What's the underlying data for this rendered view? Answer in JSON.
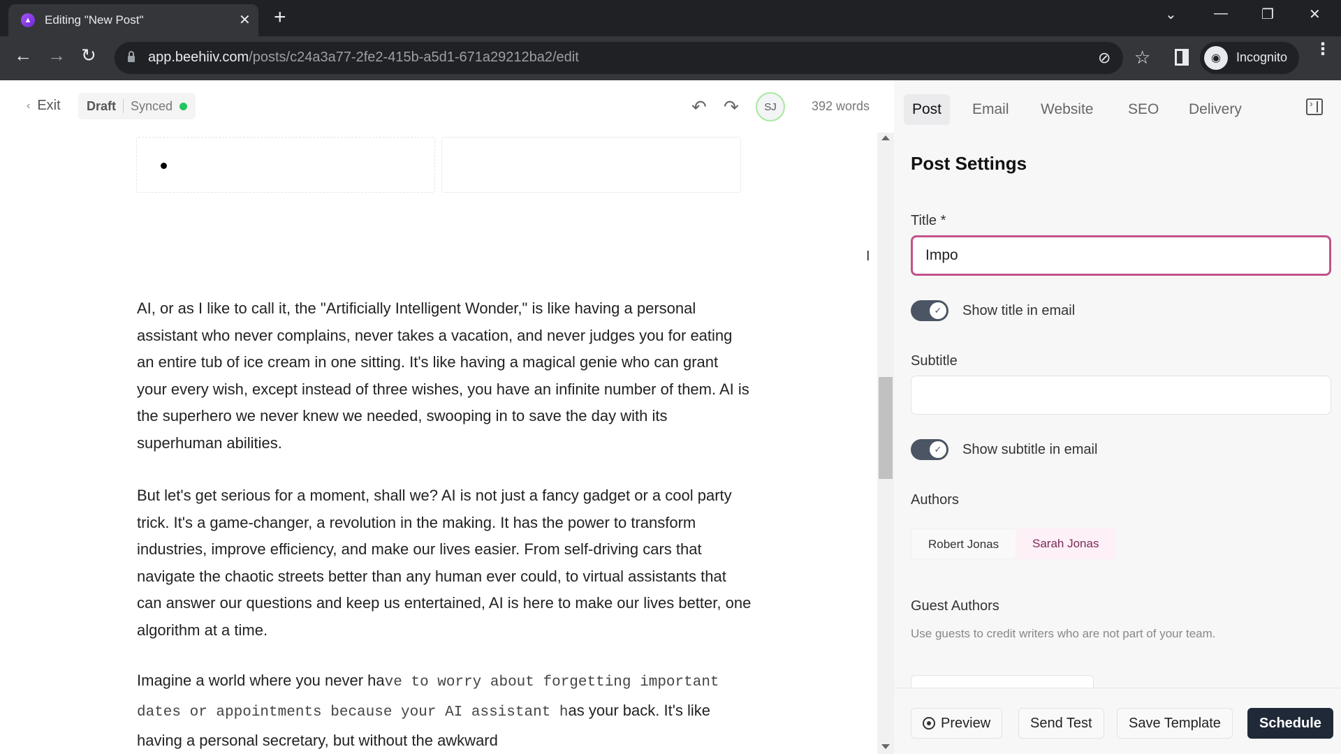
{
  "browser": {
    "tab_title": "Editing \"New Post\"",
    "url_host": "app.beehiiv.com",
    "url_path": "/posts/c24a3a77-2fe2-415b-a5d1-671a29212ba2/edit",
    "profile_label": "Incognito",
    "icons": {
      "close": "✕",
      "new_tab": "+",
      "back": "←",
      "forward": "→",
      "reload": "↻",
      "tab_search": "⌄",
      "minimize": "—",
      "restore": "❐",
      "window_close": "✕",
      "eye_off": "⊘",
      "star": "☆",
      "menu": "⋮",
      "incognito": "◉"
    }
  },
  "header": {
    "exit_label": "Exit",
    "status": "Draft",
    "sync_status": "Synced",
    "sync_color": "#22c55e",
    "avatar_initials": "SJ",
    "word_count": "392 words",
    "icons": {
      "back_chevron": "‹",
      "undo": "↶",
      "redo": "↷"
    }
  },
  "editor": {
    "paragraphs": [
      "AI, or as I like to call it, the \"Artificially Intelligent Wonder,\" is like having a personal assistant who never complains, never takes a vacation, and never judges you for eating an entire tub of ice cream in one sitting. It's like having a magical genie who can grant your every wish, except instead of three wishes, you have an infinite number of them. AI is the superhero we never knew we needed, swooping in to save the day with its superhuman abilities.",
      "But let's get serious for a moment, shall we? AI is not just a fancy gadget or a cool party trick. It's a game-changer, a revolution in the making. It has the power to transform industries, improve efficiency, and make our lives easier. From self-driving cars that navigate the chaotic streets better than any human ever could, to virtual assistants that can answer our questions and keep us entertained, AI is here to make our lives better, one algorithm at a time."
    ],
    "para3": {
      "part1": "Imagine a world where you never ha",
      "part2_mono": "ve to worry about forgetting important dates or appointments because your AI assistant h",
      "part3": "as your back. It's like having a personal secretary, but without the awkward"
    }
  },
  "panel": {
    "tabs": [
      {
        "label": "Post",
        "active": true
      },
      {
        "label": "Email",
        "active": false
      },
      {
        "label": "Website",
        "active": false
      },
      {
        "label": "SEO",
        "active": false
      },
      {
        "label": "Delivery",
        "active": false
      }
    ],
    "title": "Post Settings",
    "title_field": {
      "label": "Title *",
      "value": "Impo",
      "accent": "#c2528b"
    },
    "show_title_toggle": {
      "label": "Show title in email",
      "on": true
    },
    "subtitle_field": {
      "label": "Subtitle",
      "value": ""
    },
    "show_subtitle_toggle": {
      "label": "Show subtitle in email",
      "on": true
    },
    "authors": {
      "label": "Authors",
      "items": [
        "Robert Jonas",
        "Sarah Jonas"
      ]
    },
    "guest_authors": {
      "label": "Guest Authors",
      "description": "Use guests to credit writers who are not part of your team."
    },
    "footer": {
      "preview": "Preview",
      "send_test": "Send Test",
      "save_template": "Save Template",
      "schedule": "Schedule"
    }
  }
}
